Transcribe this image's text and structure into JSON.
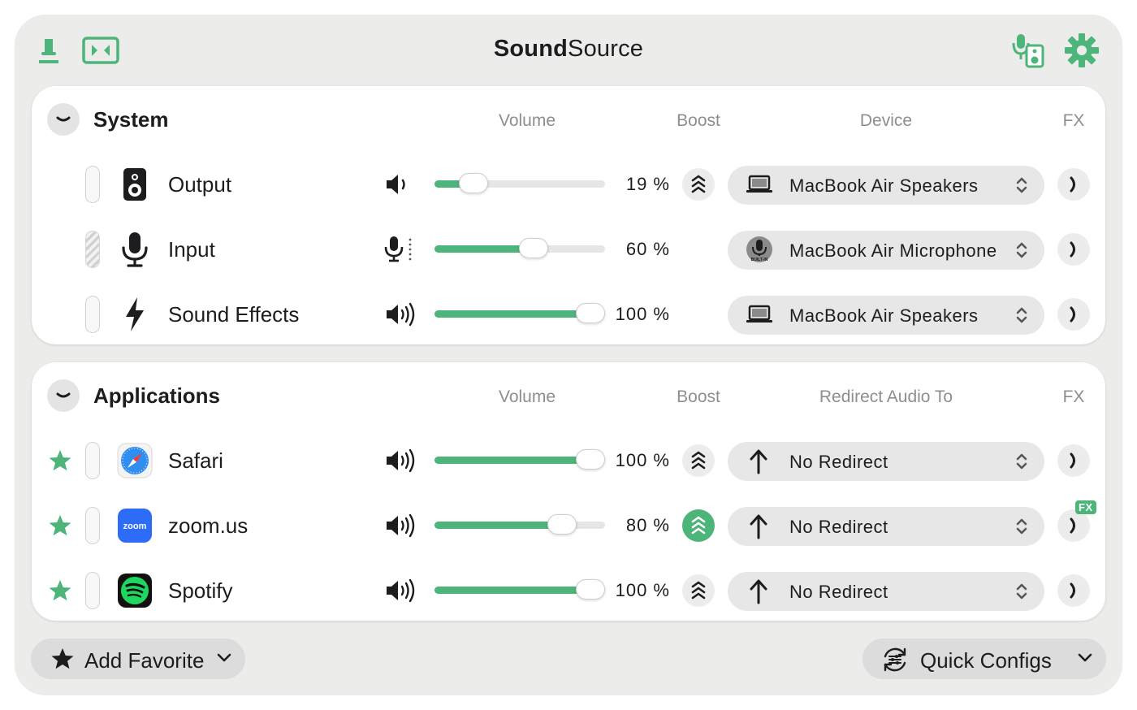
{
  "app": {
    "title_bold": "Sound",
    "title_light": "Source"
  },
  "colors": {
    "accent": "#4db57a",
    "window_bg": "#ececeb"
  },
  "toolbar": {
    "pin_icon": "pin-icon",
    "compact_icon": "compact-view-icon",
    "mic_speaker_icon": "mic-speaker-icon",
    "settings_icon": "gear-icon"
  },
  "system": {
    "title": "System",
    "headers": {
      "volume": "Volume",
      "boost": "Boost",
      "device": "Device",
      "fx": "FX"
    },
    "rows": [
      {
        "label": "Output",
        "icon": "speaker-icon",
        "volume_icon": "speaker-low-icon",
        "volume": 19,
        "volume_text": "19 %",
        "boost": true,
        "boost_on": false,
        "device": "MacBook Air Speakers",
        "device_icon": "laptop-icon"
      },
      {
        "label": "Input",
        "icon": "microphone-icon",
        "volume_icon": "microphone-level-icon",
        "volume": 60,
        "volume_text": "60 %",
        "boost": false,
        "boost_on": false,
        "device": "MacBook Air Microphone",
        "device_icon": "builtin-mic-icon",
        "device_icon_text": "BUILT-IN"
      },
      {
        "label": "Sound Effects",
        "icon": "lightning-icon",
        "volume_icon": "speaker-high-icon",
        "volume": 100,
        "volume_text": "100 %",
        "boost": false,
        "boost_on": false,
        "device": "MacBook Air Speakers",
        "device_icon": "laptop-icon"
      }
    ]
  },
  "applications": {
    "title": "Applications",
    "headers": {
      "volume": "Volume",
      "boost": "Boost",
      "device": "Redirect Audio To",
      "fx": "FX"
    },
    "rows": [
      {
        "label": "Safari",
        "icon": "safari-icon",
        "volume": 100,
        "volume_text": "100 %",
        "boost_on": false,
        "device": "No Redirect",
        "fx_badge": ""
      },
      {
        "label": "zoom.us",
        "icon": "zoom-icon",
        "icon_text": "zoom",
        "volume": 80,
        "volume_text": "80 %",
        "boost_on": true,
        "device": "No Redirect",
        "fx_badge": "FX"
      },
      {
        "label": "Spotify",
        "icon": "spotify-icon",
        "volume": 100,
        "volume_text": "100 %",
        "boost_on": false,
        "device": "No Redirect",
        "fx_badge": ""
      }
    ]
  },
  "footer": {
    "add_favorite": "Add Favorite",
    "quick_configs": "Quick Configs"
  }
}
